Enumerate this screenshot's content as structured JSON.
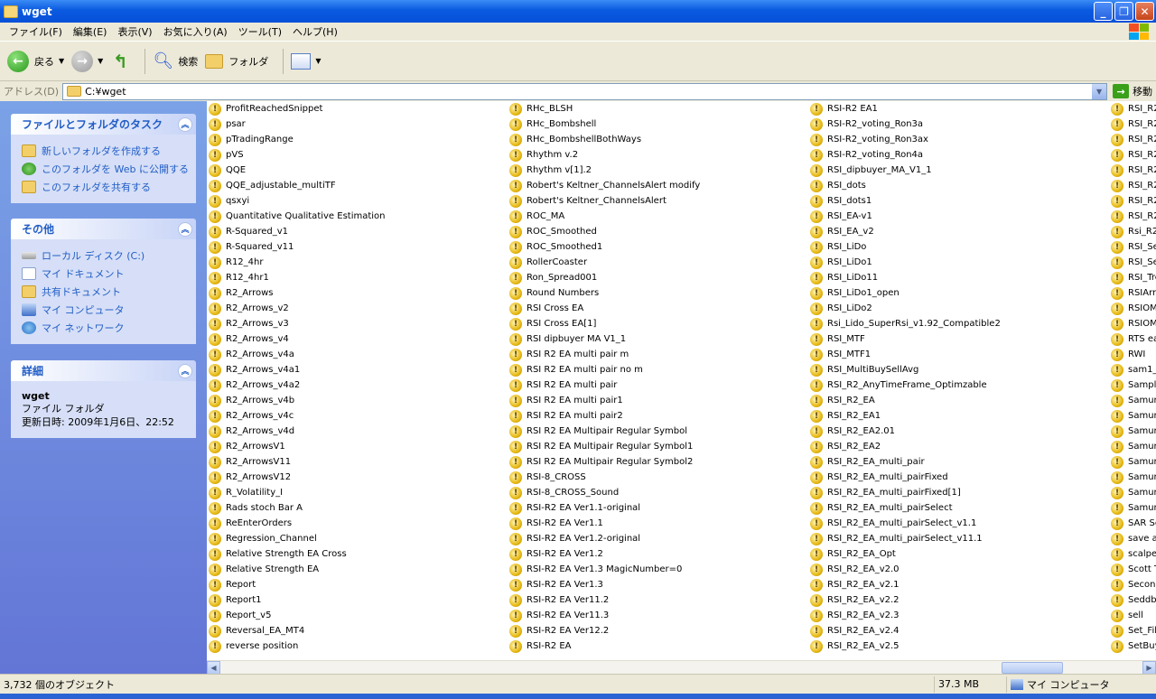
{
  "window": {
    "title": "wget"
  },
  "menu": [
    "ファイル(F)",
    "編集(E)",
    "表示(V)",
    "お気に入り(A)",
    "ツール(T)",
    "ヘルプ(H)"
  ],
  "toolbar": {
    "back": "戻る",
    "search": "検索",
    "folders": "フォルダ"
  },
  "address": {
    "label": "アドレス(D)",
    "value": "C:¥wget",
    "go": "移動"
  },
  "sidebar": {
    "tasks": {
      "title": "ファイルとフォルダのタスク",
      "items": [
        "新しいフォルダを作成する",
        "このフォルダを Web に公開する",
        "このフォルダを共有する"
      ]
    },
    "other": {
      "title": "その他",
      "items": [
        "ローカル ディスク (C:)",
        "マイ ドキュメント",
        "共有ドキュメント",
        "マイ コンピュータ",
        "マイ ネットワーク"
      ]
    },
    "details": {
      "title": "詳細",
      "name": "wget",
      "type": "ファイル フォルダ",
      "modified": "更新日時: 2009年1月6日、22:52"
    }
  },
  "files": {
    "col1": [
      "ProfitReachedSnippet",
      "psar",
      "pTradingRange",
      "pVS",
      "QQE",
      "QQE_adjustable_multiTF",
      "qsxyi",
      "Quantitative Qualitative Estimation",
      "R-Squared_v1",
      "R-Squared_v11",
      "R12_4hr",
      "R12_4hr1",
      "R2_Arrows",
      "R2_Arrows_v2",
      "R2_Arrows_v3",
      "R2_Arrows_v4",
      "R2_Arrows_v4a",
      "R2_Arrows_v4a1",
      "R2_Arrows_v4a2",
      "R2_Arrows_v4b",
      "R2_Arrows_v4c",
      "R2_Arrows_v4d",
      "R2_ArrowsV1",
      "R2_ArrowsV11",
      "R2_ArrowsV12",
      "R_Volatility_I",
      "Rads stoch Bar A",
      "ReEnterOrders",
      "Regression_Channel",
      "Relative Strength EA Cross",
      "Relative Strength EA",
      "Report",
      "Report1",
      "Report_v5",
      "Reversal_EA_MT4",
      "reverse position"
    ],
    "col2": [
      "RHc_BLSH",
      "RHc_Bombshell",
      "RHc_BombshellBothWays",
      "Rhythm v.2",
      "Rhythm v[1].2",
      "Robert's Keltner_ChannelsAlert modify",
      "Robert's Keltner_ChannelsAlert",
      "ROC_MA",
      "ROC_Smoothed",
      "ROC_Smoothed1",
      "RollerCoaster",
      "Ron_Spread001",
      "Round Numbers",
      "RSI Cross EA",
      "RSI Cross EA[1]",
      "RSI dipbuyer MA V1_1",
      "RSI R2 EA multi pair m",
      "RSI R2 EA multi pair no m",
      "RSI R2 EA multi pair",
      "RSI R2 EA multi pair1",
      "RSI R2 EA multi pair2",
      "RSI R2 EA Multipair Regular Symbol",
      "RSI R2 EA Multipair Regular Symbol1",
      "RSI R2 EA Multipair Regular Symbol2",
      "RSI-8_CROSS",
      "RSI-8_CROSS_Sound",
      "RSI-R2 EA Ver1.1-original",
      "RSI-R2 EA Ver1.1",
      "RSI-R2 EA Ver1.2-original",
      "RSI-R2 EA Ver1.2",
      "RSI-R2 EA Ver1.3 MagicNumber=0",
      "RSI-R2 EA Ver1.3",
      "RSI-R2 EA Ver11.2",
      "RSI-R2 EA Ver11.3",
      "RSI-R2 EA Ver12.2",
      "RSI-R2 EA"
    ],
    "col3": [
      "RSI-R2 EA1",
      "RSI-R2_voting_Ron3a",
      "RSI-R2_voting_Ron3ax",
      "RSI-R2_voting_Ron4a",
      "RSI_dipbuyer_MA_V1_1",
      "RSI_dots",
      "RSI_dots1",
      "RSI_EA-v1",
      "RSI_EA_v2",
      "RSI_LiDo",
      "RSI_LiDo1",
      "RSI_LiDo11",
      "RSI_LiDo1_open",
      "RSI_LiDo2",
      "Rsi_Lido_SuperRsi_v1.92_Compatible2",
      "RSI_MTF",
      "RSI_MTF1",
      "RSI_MultiBuySellAvg",
      "RSI_R2_AnyTimeFrame_Optimzable",
      "RSI_R2_EA",
      "RSI_R2_EA1",
      "RSI_R2_EA2.01",
      "RSI_R2_EA2",
      "RSI_R2_EA_multi_pair",
      "RSI_R2_EA_multi_pairFixed",
      "RSI_R2_EA_multi_pairFixed[1]",
      "RSI_R2_EA_multi_pairSelect",
      "RSI_R2_EA_multi_pairSelect_v1.1",
      "RSI_R2_EA_multi_pairSelect_v11.1",
      "RSI_R2_EA_Opt",
      "RSI_R2_EA_v2.0",
      "RSI_R2_EA_v2.1",
      "RSI_R2_EA_v2.2",
      "RSI_R2_EA_v2.3",
      "RSI_R2_EA_v2.4",
      "RSI_R2_EA_v2.5"
    ],
    "col4": [
      "RSI_R2",
      "RSI_R2",
      "RSI_R2",
      "RSI_R2",
      "RSI_R2",
      "RSI_R2",
      "RSI_R2",
      "RSI_R2",
      "Rsi_R2_",
      "RSI_Se",
      "RSI_Se",
      "RSI_Tre",
      "RSIArr",
      "RSIOM",
      "RSIOM",
      "RTS ea",
      "RWI",
      "sam1_Ir",
      "Sample",
      "Samura",
      "Samura",
      "Samura",
      "Samura",
      "Samura",
      "Samura",
      "Samura",
      "Samura",
      "SAR Se",
      "save all",
      "scalpe>",
      "Scott T",
      "Second",
      "Seddbo",
      "sell",
      "Set_Fib",
      "SetBuy"
    ]
  },
  "status": {
    "objects": "3,732 個のオブジェクト",
    "size": "37.3 MB",
    "location": "マイ コンピュータ"
  }
}
